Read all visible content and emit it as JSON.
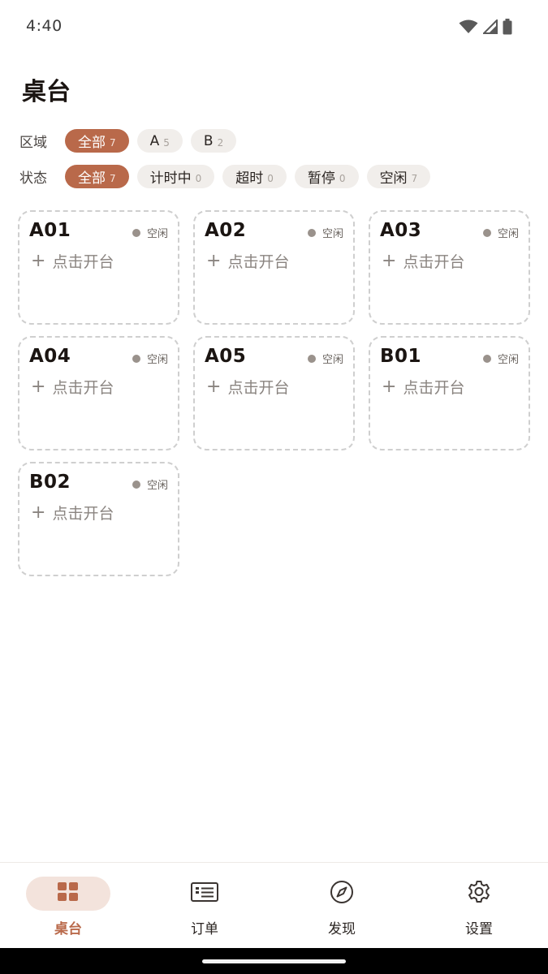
{
  "status_bar": {
    "time": "4:40"
  },
  "page": {
    "title": "桌台"
  },
  "filters": {
    "area": {
      "label": "区域",
      "chips": [
        {
          "label": "全部",
          "count": "7",
          "active": true
        },
        {
          "label": "A",
          "count": "5",
          "active": false
        },
        {
          "label": "B",
          "count": "2",
          "active": false
        }
      ]
    },
    "state": {
      "label": "状态",
      "chips": [
        {
          "label": "全部",
          "count": "7",
          "active": true
        },
        {
          "label": "计时中",
          "count": "0",
          "active": false
        },
        {
          "label": "超时",
          "count": "0",
          "active": false
        },
        {
          "label": "暂停",
          "count": "0",
          "active": false
        },
        {
          "label": "空闲",
          "count": "7",
          "active": false
        }
      ]
    }
  },
  "tables": [
    {
      "name": "A01",
      "status": "空闲",
      "action": "点击开台"
    },
    {
      "name": "A02",
      "status": "空闲",
      "action": "点击开台"
    },
    {
      "name": "A03",
      "status": "空闲",
      "action": "点击开台"
    },
    {
      "name": "A04",
      "status": "空闲",
      "action": "点击开台"
    },
    {
      "name": "A05",
      "status": "空闲",
      "action": "点击开台"
    },
    {
      "name": "B01",
      "status": "空闲",
      "action": "点击开台"
    },
    {
      "name": "B02",
      "status": "空闲",
      "action": "点击开台"
    }
  ],
  "bottom_nav": [
    {
      "label": "桌台",
      "icon": "grid-icon",
      "active": true
    },
    {
      "label": "订单",
      "icon": "list-icon",
      "active": false
    },
    {
      "label": "发现",
      "icon": "compass-icon",
      "active": false
    },
    {
      "label": "设置",
      "icon": "gear-icon",
      "active": false
    }
  ],
  "colors": {
    "accent": "#b9694a",
    "accent_soft": "#f3e3dc",
    "chip_bg": "#f1eeeb",
    "idle_dot": "#9a928c"
  }
}
